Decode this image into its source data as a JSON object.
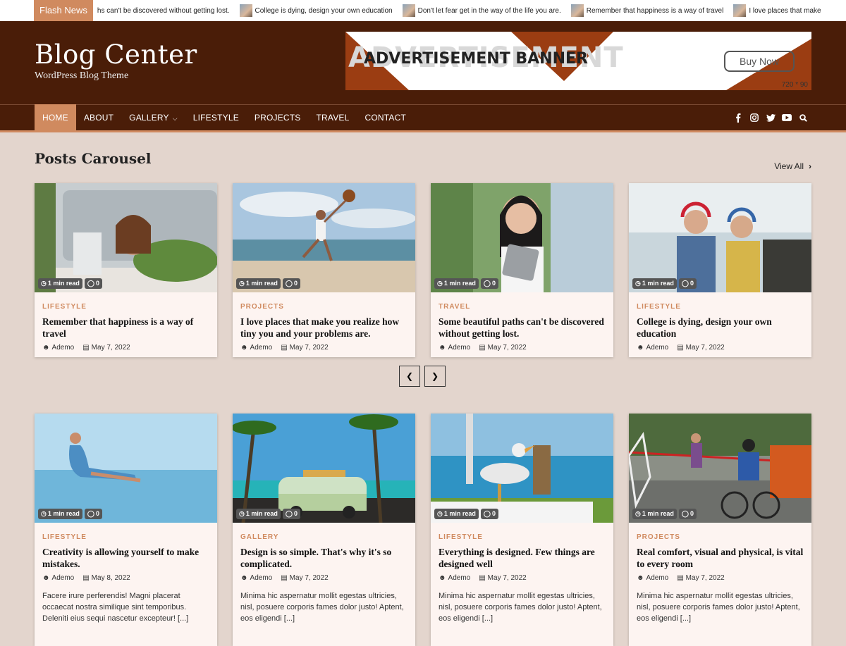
{
  "flash": {
    "label": "Flash News",
    "items": [
      {
        "text": "hs can't be discovered without getting lost.",
        "thumb": false
      },
      {
        "text": "College is dying, design your own education",
        "thumb": true
      },
      {
        "text": "Don't let fear get in the way of the life you are.",
        "thumb": true
      },
      {
        "text": "Remember that happiness is a way of travel",
        "thumb": true
      },
      {
        "text": "I love places that make",
        "thumb": true
      }
    ]
  },
  "site": {
    "title": "Blog Center",
    "tagline": "WordPress Blog Theme"
  },
  "ad": {
    "ghost_text": "ADVERTISEMENT",
    "text": "ADVERTISEMENT BANNER",
    "button": "Buy Now",
    "size": "720 * 90"
  },
  "nav": {
    "items": [
      {
        "label": "HOME",
        "active": true
      },
      {
        "label": "ABOUT"
      },
      {
        "label": "GALLERY",
        "dropdown": true
      },
      {
        "label": "LIFESTYLE"
      },
      {
        "label": "PROJECTS"
      },
      {
        "label": "TRAVEL"
      },
      {
        "label": "CONTACT"
      }
    ],
    "social": [
      "facebook-icon",
      "instagram-icon",
      "twitter-icon",
      "youtube-icon",
      "search-icon"
    ]
  },
  "carousel": {
    "title": "Posts Carousel",
    "view_all": "View All"
  },
  "badges": {
    "read": "1 min read",
    "comments": "0"
  },
  "posts_top": [
    {
      "category": "LIFESTYLE",
      "title": "Remember that happiness is a way of travel",
      "author": "Ademo",
      "date": "May 7, 2022"
    },
    {
      "category": "PROJECTS",
      "title": "I love places that make you realize how tiny you and your problems are.",
      "author": "Ademo",
      "date": "May 7, 2022"
    },
    {
      "category": "TRAVEL",
      "title": "Some beautiful paths can't be discovered without getting lost.",
      "author": "Ademo",
      "date": "May 7, 2022"
    },
    {
      "category": "LIFESTYLE",
      "title": "College is dying, design your own education",
      "author": "Ademo",
      "date": "May 7, 2022"
    }
  ],
  "posts_bottom": [
    {
      "category": "LIFESTYLE",
      "title": "Creativity is allowing yourself to make mistakes.",
      "author": "Ademo",
      "date": "May 8, 2022",
      "excerpt": "Facere irure perferendis! Magni placerat occaecat nostra similique sint temporibus. Deleniti eius sequi nascetur excepteur! [...]"
    },
    {
      "category": "GALLERY",
      "title": "Design is so simple. That's why it's so complicated.",
      "author": "Ademo",
      "date": "May 7, 2022",
      "excerpt": "Minima hic aspernatur mollit egestas ultricies, nisl, posuere corporis fames dolor justo! Aptent, eos eligendi [...]"
    },
    {
      "category": "LIFESTYLE",
      "title": "Everything is designed. Few things are designed well",
      "author": "Ademo",
      "date": "May 7, 2022",
      "excerpt": "Minima hic aspernatur mollit egestas ultricies, nisl, posuere corporis fames dolor justo! Aptent, eos eligendi [...]"
    },
    {
      "category": "PROJECTS",
      "title": "Real comfort, visual and physical, is vital to every room",
      "author": "Ademo",
      "date": "May 7, 2022",
      "excerpt": "Minima hic aspernatur mollit egestas ultricies, nisl, posuere corporis fames dolor justo! Aptent, eos eligendi [...]"
    }
  ],
  "colors": {
    "accent": "#d08a5f",
    "header_bg": "#4a1d08",
    "page_bg": "#e3d5cd",
    "card_bg": "#fdf4f1"
  }
}
